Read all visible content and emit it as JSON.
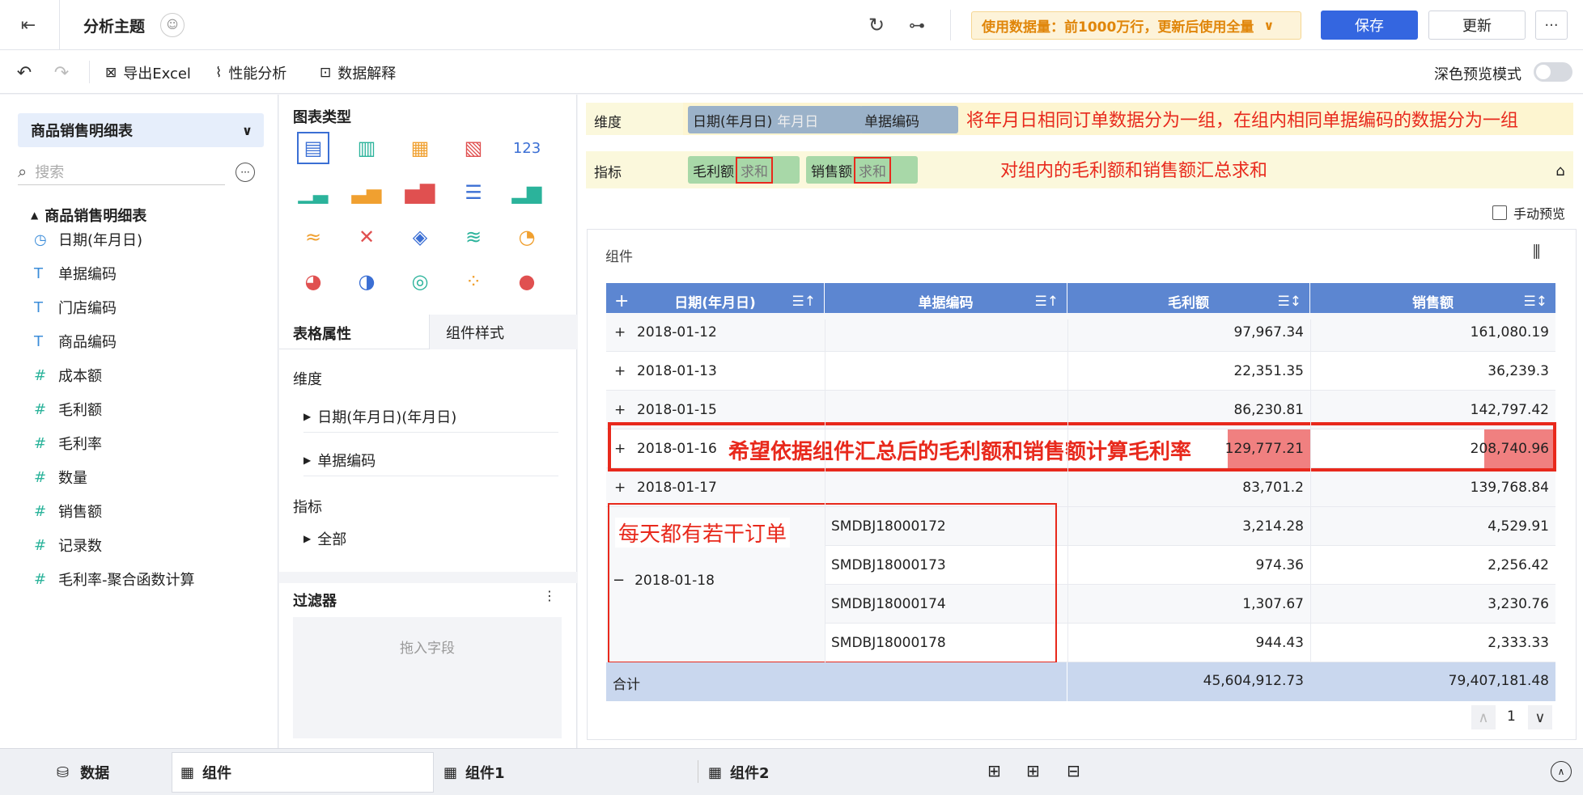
{
  "header": {
    "title": "分析主题",
    "data_notice": "使用数据量：前1000万行，更新后使用全量",
    "save": "保存",
    "update": "更新",
    "more": "···"
  },
  "toolbar": {
    "export_excel": "导出Excel",
    "perf": "性能分析",
    "explain": "数据解释",
    "dark_mode": "深色预览模式"
  },
  "left": {
    "dataset": "商品销售明细表",
    "search_placeholder": "搜索",
    "tree_root": "商品销售明细表",
    "fields": [
      {
        "icon": "clock-icon",
        "glyph": "◷",
        "label": "日期(年月日)"
      },
      {
        "icon": "text-icon",
        "glyph": "T",
        "label": "单据编码"
      },
      {
        "icon": "text-icon",
        "glyph": "T",
        "label": "门店编码"
      },
      {
        "icon": "text-icon",
        "glyph": "T",
        "label": "商品编码"
      },
      {
        "icon": "number-icon",
        "glyph": "#",
        "label": "成本额"
      },
      {
        "icon": "number-icon",
        "glyph": "#",
        "label": "毛利额"
      },
      {
        "icon": "number-icon",
        "glyph": "#",
        "label": "毛利率"
      },
      {
        "icon": "number-icon",
        "glyph": "#",
        "label": "数量"
      },
      {
        "icon": "number-icon",
        "glyph": "#",
        "label": "销售额"
      },
      {
        "icon": "record-count-icon",
        "glyph": "#",
        "label": "记录数"
      },
      {
        "icon": "calc-field-icon",
        "glyph": "#",
        "label": "毛利率-聚合函数计算"
      }
    ]
  },
  "mid": {
    "chart_type": "图表类型",
    "tab_props": "表格属性",
    "tab_style": "组件样式",
    "dimension": "维度",
    "dim_items": [
      "日期(年月日)(年月日)",
      "单据编码"
    ],
    "metric": "指标",
    "metric_items": [
      "全部"
    ],
    "filter": "过滤器",
    "filter_placeholder": "拖入字段"
  },
  "config": {
    "dim_label": "维度",
    "metric_label": "指标",
    "dim_pills": [
      {
        "name": "日期(年月日)",
        "sub": "年月日"
      },
      {
        "name": "单据编码",
        "sub": ""
      }
    ],
    "metric_pills": [
      {
        "name": "毛利额",
        "sub": "求和"
      },
      {
        "name": "销售额",
        "sub": "求和"
      }
    ],
    "annot1": "将年月日相同订单数据分为一组，在组内相同单据编码的数据分为一组",
    "annot2": "对组内的毛利额和销售额汇总求和",
    "manual_preview": "手动预览"
  },
  "component": {
    "title": "组件",
    "columns": [
      "日期(年月日)",
      "单据编码",
      "毛利额",
      "销售额"
    ],
    "rows": [
      {
        "date": "2018-01-12",
        "code": "",
        "gross": "97,967.34",
        "sales": "161,080.19"
      },
      {
        "date": "2018-01-13",
        "code": "",
        "gross": "22,351.35",
        "sales": "36,239.3"
      },
      {
        "date": "2018-01-15",
        "code": "",
        "gross": "86,230.81",
        "sales": "142,797.42"
      },
      {
        "date": "2018-01-16",
        "code": "",
        "gross": "129,777.21",
        "sales": "208,740.96"
      },
      {
        "date": "2018-01-17",
        "code": "",
        "gross": "83,701.2",
        "sales": "139,768.84"
      }
    ],
    "group_date": "2018-01-18",
    "group_rows": [
      {
        "code": "SMDBJ18000172",
        "gross": "3,214.28",
        "sales": "4,529.91"
      },
      {
        "code": "SMDBJ18000173",
        "gross": "974.36",
        "sales": "2,256.42"
      },
      {
        "code": "SMDBJ18000174",
        "gross": "1,307.67",
        "sales": "3,230.76"
      },
      {
        "code": "SMDBJ18000178",
        "gross": "944.43",
        "sales": "2,333.33"
      }
    ],
    "total_label": "合计",
    "total_gross": "45,604,912.73",
    "total_sales": "79,407,181.48",
    "annot_highlight": "希望依据组件汇总后的毛利额和销售额计算毛利率",
    "annot_orders": "每天都有若干订单",
    "page": "1"
  },
  "bottom": {
    "data_tab": "数据",
    "tabs": [
      "组件",
      "组件1",
      "组件2"
    ]
  }
}
